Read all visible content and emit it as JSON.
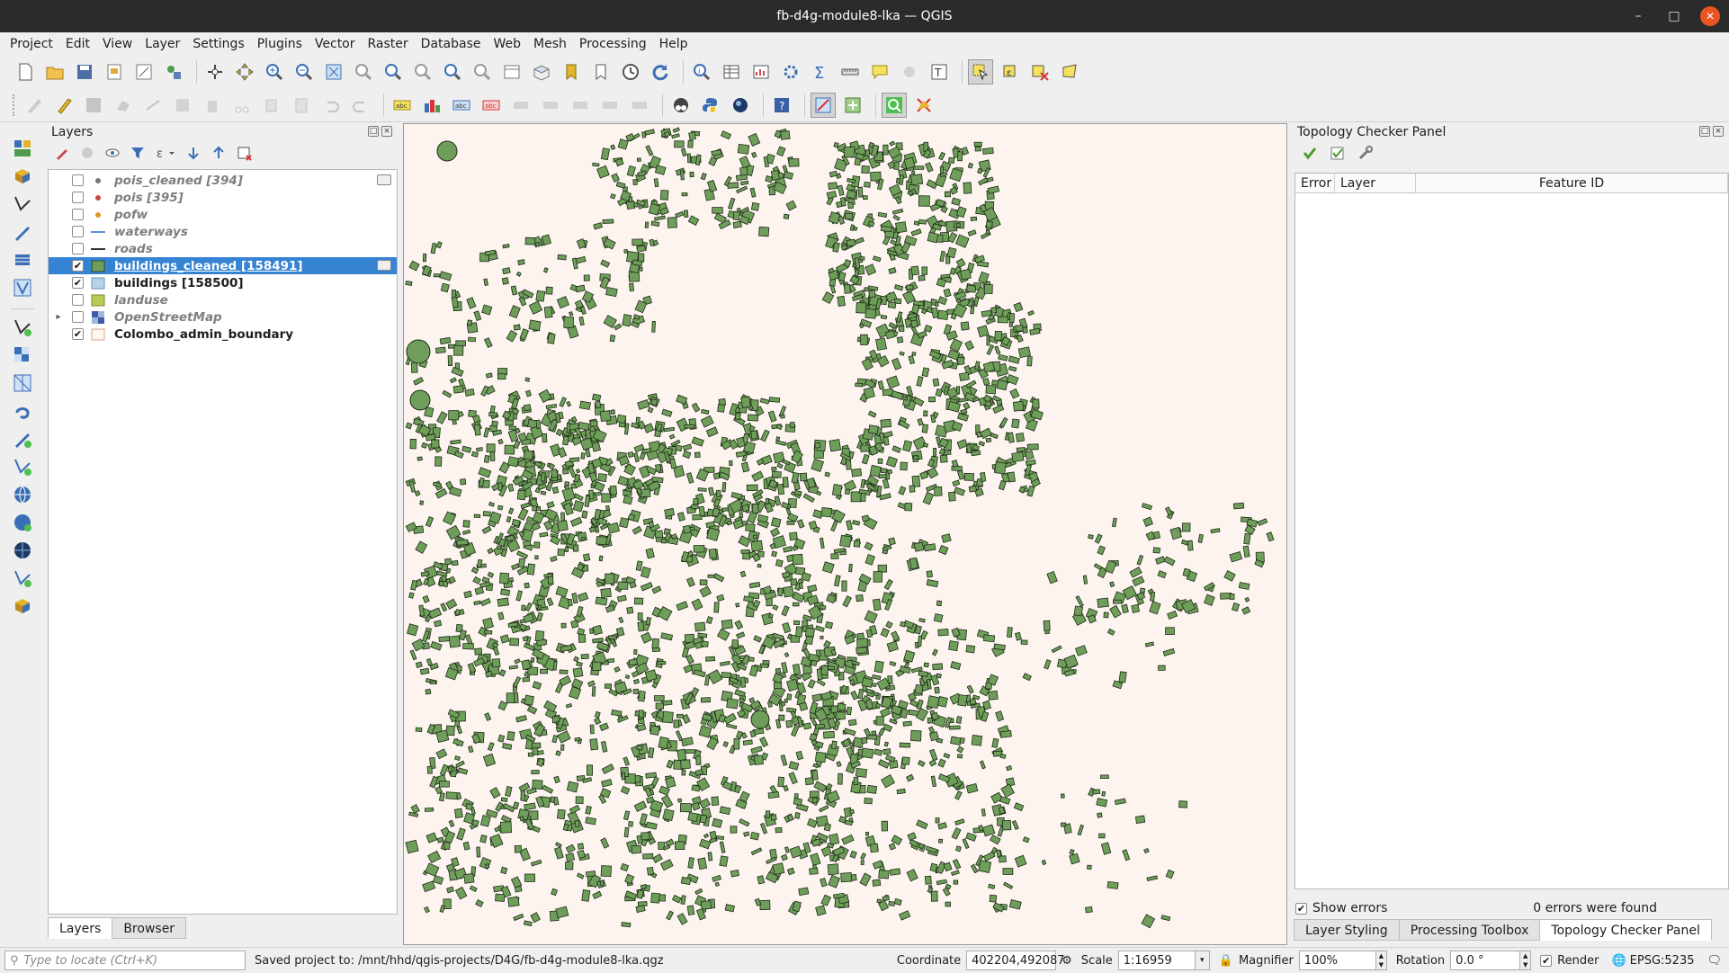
{
  "window": {
    "title": "fb-d4g-module8-lka — QGIS"
  },
  "menu": [
    "Project",
    "Edit",
    "View",
    "Layer",
    "Settings",
    "Plugins",
    "Vector",
    "Raster",
    "Database",
    "Web",
    "Mesh",
    "Processing",
    "Help"
  ],
  "layers_panel": {
    "title": "Layers",
    "layers": [
      {
        "name": "pois_cleaned [394]",
        "checked": false,
        "style": "off",
        "symbol": "point-gray"
      },
      {
        "name": "pois [395]",
        "checked": false,
        "style": "off",
        "symbol": "point-red"
      },
      {
        "name": "pofw",
        "checked": false,
        "style": "off",
        "symbol": "point-orange"
      },
      {
        "name": "waterways",
        "checked": false,
        "style": "off",
        "symbol": "line-blue"
      },
      {
        "name": "roads",
        "checked": false,
        "style": "off",
        "symbol": "line-dark"
      },
      {
        "name": "buildings_cleaned [158491]",
        "checked": true,
        "style": "selected",
        "symbol": "poly-green"
      },
      {
        "name": "buildings [158500]",
        "checked": true,
        "style": "on",
        "symbol": "poly-lightblue"
      },
      {
        "name": "landuse",
        "checked": false,
        "style": "off",
        "symbol": "poly-olive"
      },
      {
        "name": "OpenStreetMap",
        "checked": false,
        "style": "off",
        "symbol": "raster-tiles"
      },
      {
        "name": "Colombo_admin_boundary",
        "checked": true,
        "style": "on",
        "symbol": "poly-cream"
      }
    ],
    "tabs": {
      "layers": "Layers",
      "browser": "Browser"
    }
  },
  "topology_panel": {
    "title": "Topology Checker Panel",
    "columns": {
      "error": "Error",
      "layer": "Layer",
      "feature_id": "Feature ID"
    },
    "show_errors_label": "Show errors",
    "show_errors_checked": true,
    "result": "0 errors were found"
  },
  "right_tabs": {
    "styling": "Layer Styling",
    "toolbox": "Processing Toolbox",
    "topology": "Topology Checker Panel"
  },
  "statusbar": {
    "locate_placeholder": "Type to locate (Ctrl+K)",
    "message": "Saved project to: /mnt/hhd/qgis-projects/D4G/fb-d4g-module8-lka.qgz",
    "coordinate_label": "Coordinate",
    "coordinate": "402204,492087",
    "scale_label": "Scale",
    "scale": "1:16959",
    "magnifier_label": "Magnifier",
    "magnifier": "100%",
    "rotation_label": "Rotation",
    "rotation": "0.0 °",
    "render_label": "Render",
    "crs": "EPSG:5235"
  },
  "colors": {
    "selection": "#3583d3",
    "building_fill": "#6f9e5a",
    "map_bg": "#fdf4f0",
    "titlebar": "#2b2b2b"
  }
}
